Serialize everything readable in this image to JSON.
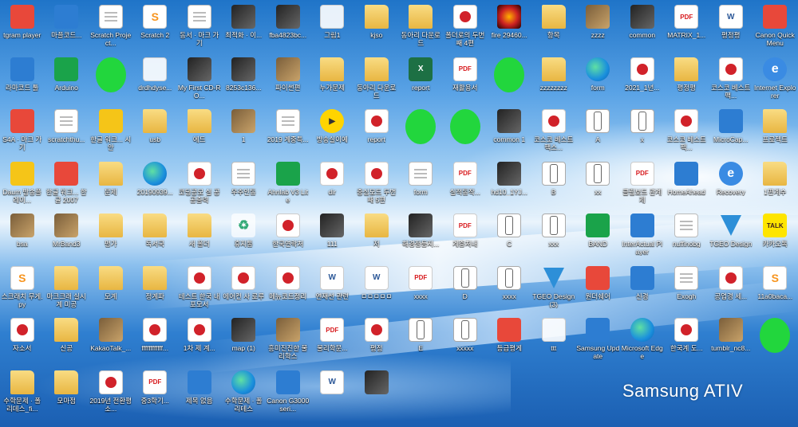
{
  "wallpaper_brand": {
    "left": "Samsung",
    "right": "ATIV"
  },
  "rows": [
    [
      {
        "label": "tgram player",
        "type": "appred"
      },
      {
        "label": "마플코드...",
        "type": "app"
      },
      {
        "label": "Scratch Project...",
        "type": "doc"
      },
      {
        "label": "Scratch 2",
        "type": "scratch"
      },
      {
        "label": "동서 · 마크 가기",
        "type": "doc"
      },
      {
        "label": "최적화 · 이...",
        "type": "imgdark"
      },
      {
        "label": "fba4823bc...",
        "type": "imgdark"
      },
      {
        "label": "그림1",
        "type": "blank"
      },
      {
        "label": "kjso",
        "type": "folder"
      },
      {
        "label": "동아리 다운로드",
        "type": "folder"
      },
      {
        "label": "폴더로의 두번째 4편",
        "type": "hwp"
      },
      {
        "label": "fire 29460...",
        "type": "fire"
      },
      {
        "label": "항목",
        "type": "folder"
      },
      {
        "label": "zzzz",
        "type": "img"
      },
      {
        "label": "common",
        "type": "imgdark"
      },
      {
        "label": "MATRIX_1...",
        "type": "pdf"
      },
      {
        "label": "평정평",
        "type": "word"
      }
    ],
    [
      {
        "label": "Canon Quick Menu",
        "type": "appred"
      },
      {
        "label": "라마코드 툴",
        "type": "app"
      },
      {
        "label": "Arduino",
        "type": "appgreen"
      },
      {
        "label": "",
        "type": "blob"
      },
      {
        "label": "drdhdyse...",
        "type": "blank"
      },
      {
        "label": "My First CD-RO...",
        "type": "imgdark"
      },
      {
        "label": "8253c136...",
        "type": "imgdark"
      },
      {
        "label": "파이썬편",
        "type": "img"
      },
      {
        "label": "누가문제",
        "type": "folder"
      },
      {
        "label": "동아리 다운로드",
        "type": "folder"
      },
      {
        "label": "report",
        "type": "excel"
      },
      {
        "label": "재활용서",
        "type": "pdf"
      },
      {
        "label": "",
        "type": "blob"
      },
      {
        "label": "zzzzzzzz",
        "type": "folder"
      },
      {
        "label": "form",
        "type": "edge"
      },
      {
        "label": "2021_1년...",
        "type": "hwp"
      },
      {
        "label": "평정평",
        "type": "folder"
      }
    ],
    [
      {
        "label": "코스코 베스트팩...",
        "type": "hwp"
      },
      {
        "label": "Internet Explorer",
        "type": "ie"
      },
      {
        "label": "S4A · 마크 가기",
        "type": "appred"
      },
      {
        "label": "scratchthu...",
        "type": "doc"
      },
      {
        "label": "한글 워크... 시안",
        "type": "appyellow"
      },
      {
        "label": "usb",
        "type": "folder"
      },
      {
        "label": "에드",
        "type": "folder"
      },
      {
        "label": "1",
        "type": "img"
      },
      {
        "label": "2019 계중특...",
        "type": "doc"
      },
      {
        "label": "방송실이예",
        "type": "media"
      },
      {
        "label": "report",
        "type": "hwp"
      },
      {
        "label": "KakaoTalk_...",
        "type": "blob"
      },
      {
        "label": "",
        "type": "blob"
      },
      {
        "label": "common 1",
        "type": "imgdark"
      },
      {
        "label": "코스코 베스트팩스...",
        "type": "hwp"
      },
      {
        "label": "A",
        "type": "sketch"
      },
      {
        "label": "x",
        "type": "sketch"
      }
    ],
    [
      {
        "label": "코스코 베스트팩...",
        "type": "hwp"
      },
      {
        "label": "MicroCap...",
        "type": "app"
      },
      {
        "label": "프로젝트",
        "type": "folder"
      },
      {
        "label": "Daum 방송플레이...",
        "type": "appyellow"
      },
      {
        "label": "한글 워크... 한글 2007",
        "type": "appred"
      },
      {
        "label": "문제",
        "type": "folder"
      },
      {
        "label": "20190939...",
        "type": "edge"
      },
      {
        "label": "코딩공모 실 공공출력",
        "type": "hwp"
      },
      {
        "label": "우주인동",
        "type": "doc"
      },
      {
        "label": "Ahnlab V3 Lite",
        "type": "appgreen"
      },
      {
        "label": "dir",
        "type": "hwp"
      },
      {
        "label": "중심모드 두번째 5편",
        "type": "hwp"
      },
      {
        "label": "form",
        "type": "doc"
      },
      {
        "label": "실적동작...",
        "type": "pdf"
      },
      {
        "label": "hd10_1YJ...",
        "type": "imgdark"
      },
      {
        "label": "B",
        "type": "sketch"
      },
      {
        "label": "xx",
        "type": "sketch"
      }
    ],
    [
      {
        "label": "클립보드 관계제",
        "type": "pdf"
      },
      {
        "label": "HomeAhead",
        "type": "app"
      },
      {
        "label": "Recovery",
        "type": "ie"
      },
      {
        "label": "1편계수",
        "type": "folder"
      },
      {
        "label": "bsa",
        "type": "img"
      },
      {
        "label": "MrBand3",
        "type": "img"
      },
      {
        "label": "평가",
        "type": "folder"
      },
      {
        "label": "독서국",
        "type": "folder"
      },
      {
        "label": "새 폴더",
        "type": "folder"
      },
      {
        "label": "휴지통",
        "type": "recycle"
      },
      {
        "label": "한국연락처",
        "type": "hwp"
      },
      {
        "label": "111",
        "type": "imgdark"
      },
      {
        "label": "저",
        "type": "folder"
      },
      {
        "label": "해경정등지...",
        "type": "imgdark"
      },
      {
        "label": "계층처내",
        "type": "pdf"
      },
      {
        "label": "C",
        "type": "sketch"
      },
      {
        "label": "xxx",
        "type": "sketch"
      }
    ],
    [
      {
        "label": "BAND",
        "type": "appgreen"
      },
      {
        "label": "InterActual Player",
        "type": "app"
      },
      {
        "label": "nuffinobg",
        "type": "doc"
      },
      {
        "label": "TGEO Design",
        "type": "diamond"
      },
      {
        "label": "카카오톡",
        "type": "talk"
      },
      {
        "label": "스크래치 무게.py",
        "type": "scratch"
      },
      {
        "label": "마크크래 실시계 미공",
        "type": "folder"
      },
      {
        "label": "모계",
        "type": "folder"
      },
      {
        "label": "정계파",
        "type": "folder"
      },
      {
        "label": "테스트 한국 내 포모서",
        "type": "hwp"
      },
      {
        "label": "에어컨 사 로루",
        "type": "hwp"
      },
      {
        "label": "메뉴코드정리",
        "type": "hwp"
      },
      {
        "label": "연재선 관련",
        "type": "word"
      },
      {
        "label": "ㅁㅁㅁㅁㅁ",
        "type": "word"
      },
      {
        "label": "xxxx",
        "type": "pdf"
      },
      {
        "label": "D",
        "type": "sketch"
      },
      {
        "label": "xxxx",
        "type": "sketch"
      }
    ],
    [
      {
        "label": "TGEO Design (3)",
        "type": "diamond"
      },
      {
        "label": "원더쉐어",
        "type": "appred"
      },
      {
        "label": "신경",
        "type": "app"
      },
      {
        "label": "Exogh",
        "type": "doc"
      },
      {
        "label": "공업경 세...",
        "type": "hwp"
      },
      {
        "label": "11a0baca...",
        "type": "scratch"
      },
      {
        "label": "자소서",
        "type": "hwp"
      },
      {
        "label": "신공",
        "type": "folder"
      },
      {
        "label": "KakaoTalk_...",
        "type": "img"
      },
      {
        "label": "ffffffffffff...",
        "type": "hwp"
      },
      {
        "label": "1차 제 계...",
        "type": "hwp"
      },
      {
        "label": "map (1)",
        "type": "imgdark"
      },
      {
        "label": "흥미진진한 물리학스",
        "type": "img"
      },
      {
        "label": "물리학문...",
        "type": "pdf"
      },
      {
        "label": "평정",
        "type": "hwp"
      },
      {
        "label": "E",
        "type": "sketch"
      },
      {
        "label": "xxxxx",
        "type": "sketch"
      }
    ],
    [
      {
        "label": "등급평게",
        "type": "appred"
      },
      {
        "label": "ttt",
        "type": "blank"
      },
      {
        "label": "Samsung Update",
        "type": "app"
      },
      {
        "label": "Microsoft Edge",
        "type": "edge"
      },
      {
        "label": "한국계 도...",
        "type": "hwp"
      },
      {
        "label": "tumblr_nc8...",
        "type": "img"
      },
      {
        "label": "KakaoTalk_...",
        "type": "blob"
      },
      {
        "label": "수학문제 · 폴리데스_fi...",
        "type": "folder"
      },
      {
        "label": "모마점",
        "type": "folder"
      },
      {
        "label": "2019년 전환평소...",
        "type": "hwp"
      },
      {
        "label": "중3학기...",
        "type": "pdf"
      },
      {
        "label": "제목 없음",
        "type": "app"
      },
      {
        "label": "수학문제 · 폴리테스",
        "type": "edge"
      },
      {
        "label": "Canon G3000 seri...",
        "type": "app"
      },
      {
        "label": "",
        "type": "word"
      },
      {
        "label": "",
        "type": "imgdark"
      }
    ]
  ]
}
